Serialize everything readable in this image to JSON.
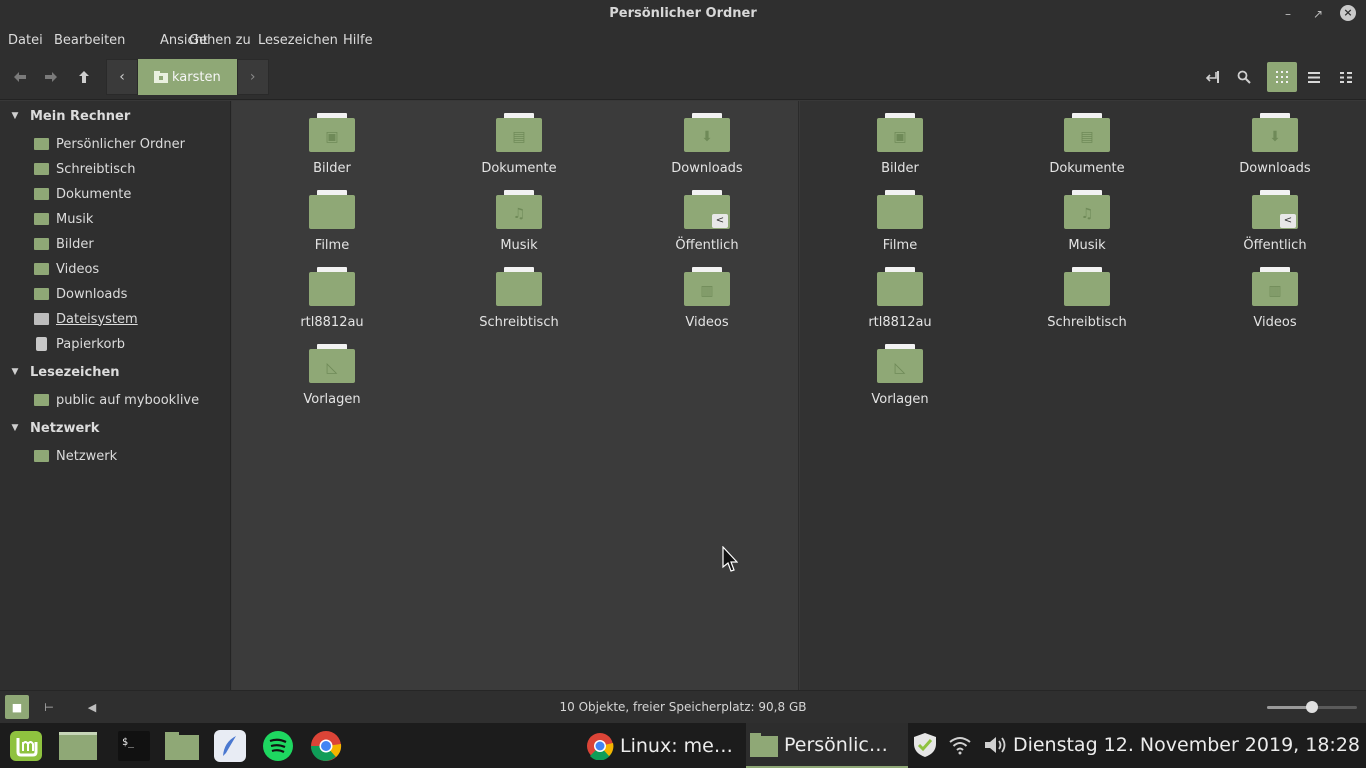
{
  "window": {
    "title": "Persönlicher Ordner"
  },
  "menubar": [
    "Datei",
    "Bearbeiten",
    "Ansicht",
    "Gehen zu",
    "Lesezeichen",
    "Hilfe"
  ],
  "toolbar": {
    "path_crumb": "karsten"
  },
  "sidebar": {
    "sections": [
      {
        "title": "Mein Rechner",
        "items": [
          {
            "label": "Persönlicher Ordner",
            "icon": "home-folder-icon"
          },
          {
            "label": "Schreibtisch",
            "icon": "desktop-folder-icon"
          },
          {
            "label": "Dokumente",
            "icon": "documents-folder-icon"
          },
          {
            "label": "Musik",
            "icon": "music-folder-icon"
          },
          {
            "label": "Bilder",
            "icon": "pictures-folder-icon"
          },
          {
            "label": "Videos",
            "icon": "videos-folder-icon"
          },
          {
            "label": "Downloads",
            "icon": "downloads-folder-icon"
          },
          {
            "label": "Dateisystem",
            "icon": "drive-icon"
          },
          {
            "label": "Papierkorb",
            "icon": "trash-icon"
          }
        ]
      },
      {
        "title": "Lesezeichen",
        "items": [
          {
            "label": "public auf mybooklive",
            "icon": "network-folder-icon"
          }
        ]
      },
      {
        "title": "Netzwerk",
        "items": [
          {
            "label": "Netzwerk",
            "icon": "network-icon"
          }
        ]
      }
    ]
  },
  "files": [
    {
      "name": "Bilder",
      "emblem": "camera"
    },
    {
      "name": "Dokumente",
      "emblem": "document"
    },
    {
      "name": "Downloads",
      "emblem": "download"
    },
    {
      "name": "Filme",
      "emblem": ""
    },
    {
      "name": "Musik",
      "emblem": "music"
    },
    {
      "name": "Öffentlich",
      "emblem": "share"
    },
    {
      "name": "rtl8812au",
      "emblem": ""
    },
    {
      "name": "Schreibtisch",
      "emblem": "desktop"
    },
    {
      "name": "Videos",
      "emblem": "film"
    },
    {
      "name": "Vorlagen",
      "emblem": "template"
    }
  ],
  "status": {
    "text": "10 Objekte, freier Speicherplatz: 90,8 GB",
    "zoom_level": 0.5
  },
  "taskbar": {
    "tasks": [
      {
        "label": "Linux: me…",
        "icon": "chrome-icon"
      },
      {
        "label": "Persönlic…",
        "icon": "folder-icon"
      }
    ],
    "clock": "Dienstag 12. November 2019, 18:28"
  },
  "colors": {
    "accent": "#8fa876",
    "background": "#383838"
  }
}
